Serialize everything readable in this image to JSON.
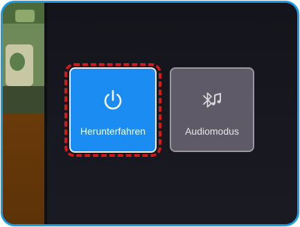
{
  "menu": {
    "tiles": [
      {
        "label": "Herunterfahren",
        "icon": "power-icon",
        "state": "focused"
      },
      {
        "label": "Audiomodus",
        "icon": "bluetooth-music-icon",
        "state": "default"
      }
    ]
  },
  "colors": {
    "frame_border": "#1a9be8",
    "focused_tile": "#1a8cf2",
    "default_tile": "#5e5a67",
    "focus_ring": "#d11a1a",
    "background": "#17171f"
  }
}
